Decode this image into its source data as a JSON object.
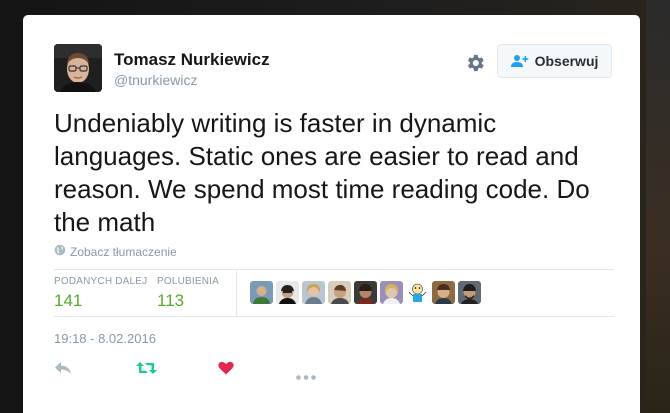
{
  "user": {
    "name": "Tomasz Nurkiewicz",
    "handle": "@tnurkiewicz"
  },
  "follow_button": {
    "label": "Obserwuj",
    "icon": "add-user-icon"
  },
  "tweet": {
    "text": "Undeniably writing is faster in dynamic languages. Static ones are easier to read and reason. We spend most time reading code. Do the math"
  },
  "translate": {
    "label": "Zobacz tłumaczenie",
    "icon": "globe-icon"
  },
  "stats": {
    "retweets_label": "PODANYCH DALEJ",
    "retweets_count": "141",
    "likes_label": "POLUBIENIA",
    "likes_count": "113"
  },
  "timestamp": "19:18 - 8.02.2016",
  "colors": {
    "retweet_green": "#19cf86",
    "like_red": "#e2264d",
    "count_green": "#55ac2b",
    "muted": "#8899a6"
  },
  "actions": [
    "reply-icon",
    "retweet-icon",
    "heart-icon",
    "more-icon"
  ]
}
